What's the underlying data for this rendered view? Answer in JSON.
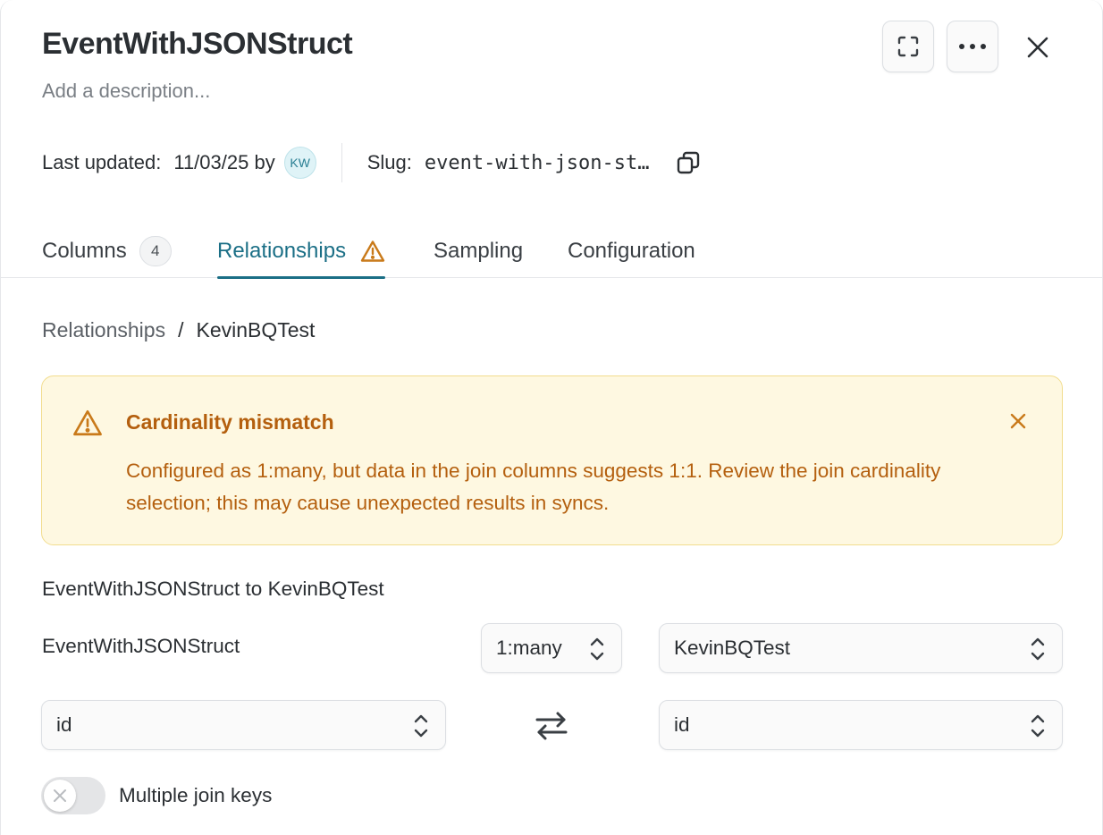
{
  "header": {
    "title": "EventWithJSONStruct",
    "description_placeholder": "Add a description..."
  },
  "actions": {
    "expand_icon": "expand-icon",
    "more_icon": "more-horizontal-icon",
    "close_icon": "close-icon"
  },
  "meta": {
    "last_updated_label": "Last updated:",
    "last_updated_date": "11/03/25 by",
    "avatar_initials": "KW",
    "slug_label": "Slug:",
    "slug_value": "event-with-json-st…"
  },
  "tabs": [
    {
      "label": "Columns",
      "count": "4"
    },
    {
      "label": "Relationships",
      "active": true,
      "warning": true
    },
    {
      "label": "Sampling"
    },
    {
      "label": "Configuration"
    }
  ],
  "breadcrumb": {
    "parent": "Relationships",
    "separator": "/",
    "current": "KevinBQTest"
  },
  "alert": {
    "title": "Cardinality mismatch",
    "body": "Configured as 1:many, but data in the join columns suggests 1:1. Review the join cardinality selection; this may cause unexpected results in syncs.",
    "color": "#b45f0e",
    "background": "#fef8e1"
  },
  "relationship": {
    "heading": "EventWithJSONStruct to KevinBQTest",
    "source_model": "EventWithJSONStruct",
    "cardinality": "1:many",
    "target_model": "KevinBQTest",
    "source_key": "id",
    "target_key": "id"
  },
  "toggle": {
    "label": "Multiple join keys",
    "on": false
  },
  "colors": {
    "accent": "#1b6f86",
    "warning": "#c97a1a"
  }
}
